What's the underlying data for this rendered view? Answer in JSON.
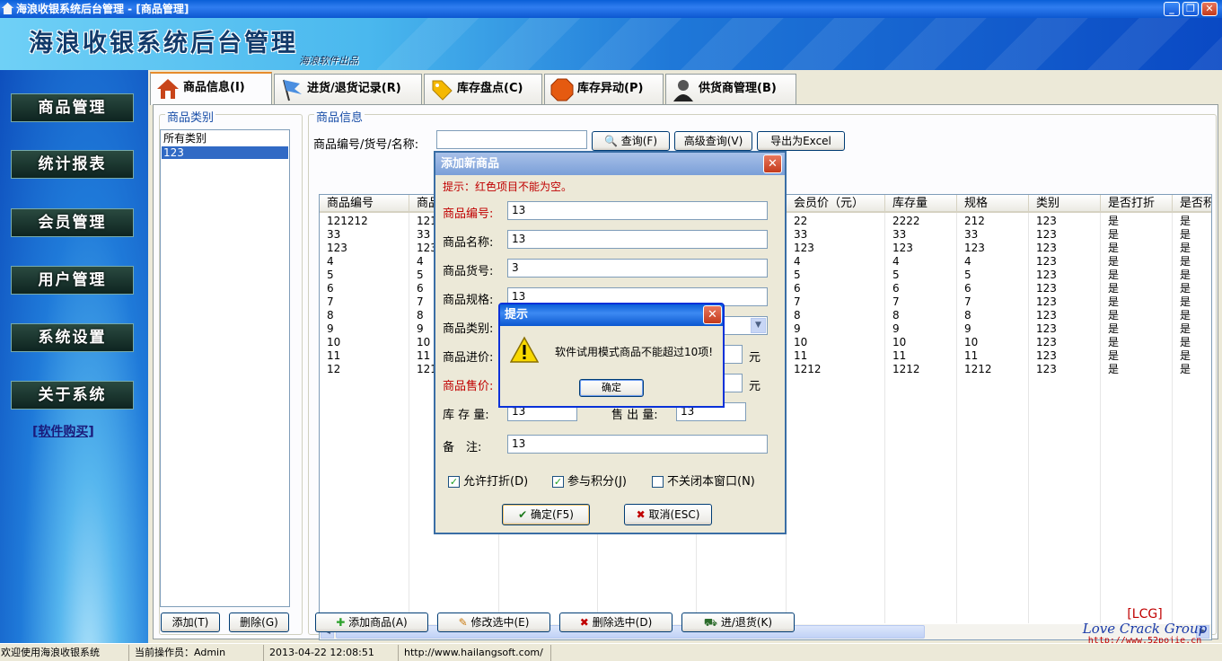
{
  "window": {
    "title": "海浪收银系统后台管理 - [商品管理]",
    "controls": [
      "_",
      "❐",
      "✕"
    ]
  },
  "banner": {
    "title": "海浪收银系统后台管理",
    "subtitle": "海浪软件出品"
  },
  "sidebar": {
    "items": [
      {
        "label": "商品管理"
      },
      {
        "label": "统计报表"
      },
      {
        "label": "会员管理"
      },
      {
        "label": "用户管理"
      },
      {
        "label": "系统设置"
      },
      {
        "label": "关于系统"
      }
    ],
    "buy_link": "[软件购买]"
  },
  "tabs": [
    {
      "label": "商品信息(I)",
      "icon": "home-icon"
    },
    {
      "label": "进货/退货记录(R)",
      "icon": "flag-icon"
    },
    {
      "label": "库存盘点(C)",
      "icon": "tag-icon"
    },
    {
      "label": "库存异动(P)",
      "icon": "stop-sign-icon"
    },
    {
      "label": "供货商管理(B)",
      "icon": "person-icon"
    }
  ],
  "category_panel": {
    "legend": "商品类别",
    "items": [
      "所有类别",
      "123"
    ],
    "selected": "123",
    "add_label": "添加(T)",
    "delete_label": "删除(G)"
  },
  "product_panel": {
    "legend": "商品信息",
    "search_label": "商品编号/货号/名称:",
    "search_value": "",
    "query_label": "查询(F)",
    "advanced_label": "高级查询(V)",
    "export_label": "导出为Excel",
    "columns": [
      "商品编号",
      "商品",
      "",
      "",
      "会员价（元）",
      "库存量",
      "规格",
      "类别",
      "是否打折",
      "是否积"
    ],
    "rows": [
      [
        "121212",
        "1212",
        "22",
        "2222",
        "212",
        "123",
        "是",
        "是"
      ],
      [
        "33",
        "33",
        "33",
        "33",
        "33",
        "123",
        "是",
        "是"
      ],
      [
        "123",
        "123",
        "123",
        "123",
        "123",
        "123",
        "是",
        "是"
      ],
      [
        "4",
        "4",
        "4",
        "4",
        "4",
        "123",
        "是",
        "是"
      ],
      [
        "5",
        "5",
        "5",
        "5",
        "5",
        "123",
        "是",
        "是"
      ],
      [
        "6",
        "6",
        "6",
        "6",
        "6",
        "123",
        "是",
        "是"
      ],
      [
        "7",
        "7",
        "7",
        "7",
        "7",
        "123",
        "是",
        "是"
      ],
      [
        "8",
        "8",
        "8",
        "8",
        "8",
        "123",
        "是",
        "是"
      ],
      [
        "9",
        "9",
        "9",
        "9",
        "9",
        "123",
        "是",
        "是"
      ],
      [
        "10",
        "10",
        "10",
        "10",
        "10",
        "123",
        "是",
        "是"
      ],
      [
        "11",
        "11",
        "11",
        "11",
        "11",
        "123",
        "是",
        "是"
      ],
      [
        "12",
        "1212",
        "1212",
        "1212",
        "1212",
        "123",
        "是",
        "是"
      ]
    ],
    "buttons": {
      "add": "添加商品(A)",
      "edit": "修改选中(E)",
      "delete": "删除选中(D)",
      "stock": "进/退货(K)"
    }
  },
  "add_dialog": {
    "title": "添加新商品",
    "hint": "提示：红色项目不能为空。",
    "fields": {
      "code_label": "商品编号:",
      "code_value": "13",
      "name_label": "商品名称:",
      "name_value": "13",
      "sku_label": "商品货号:",
      "sku_value": "3",
      "spec_label": "商品规格:",
      "spec_value": "13",
      "category_label": "商品类别:",
      "cost_label": "商品进价:",
      "price_label": "商品售价:",
      "unit": "元",
      "stock_label": "库 存 量:",
      "stock_value": "13",
      "sold_label": "售 出 量:",
      "sold_value": "13",
      "note_label": "备　注:",
      "note_value": "13"
    },
    "checkboxes": [
      {
        "label": "允许打折(D)",
        "checked": true
      },
      {
        "label": "参与积分(J)",
        "checked": true
      },
      {
        "label": "不关闭本窗口(N)",
        "checked": false
      }
    ],
    "ok_label": "确定(F5)",
    "cancel_label": "取消(ESC)"
  },
  "alert": {
    "title": "提示",
    "message": "软件试用模式商品不能超过10项!",
    "ok_label": "确定"
  },
  "statusbar": {
    "welcome": "欢迎使用海浪收银系统",
    "operator": "当前操作员：Admin",
    "datetime": "2013-04-22 12:08:51",
    "url": "http://www.hailangsoft.com/"
  },
  "watermark": {
    "tag": "[LCG]",
    "group": "Love Crack Group",
    "site": "http://www.52pojie.cn"
  },
  "colors": {
    "required_label": "#c00000",
    "titlebar": "#0b57d0",
    "selection": "#316ac5"
  }
}
